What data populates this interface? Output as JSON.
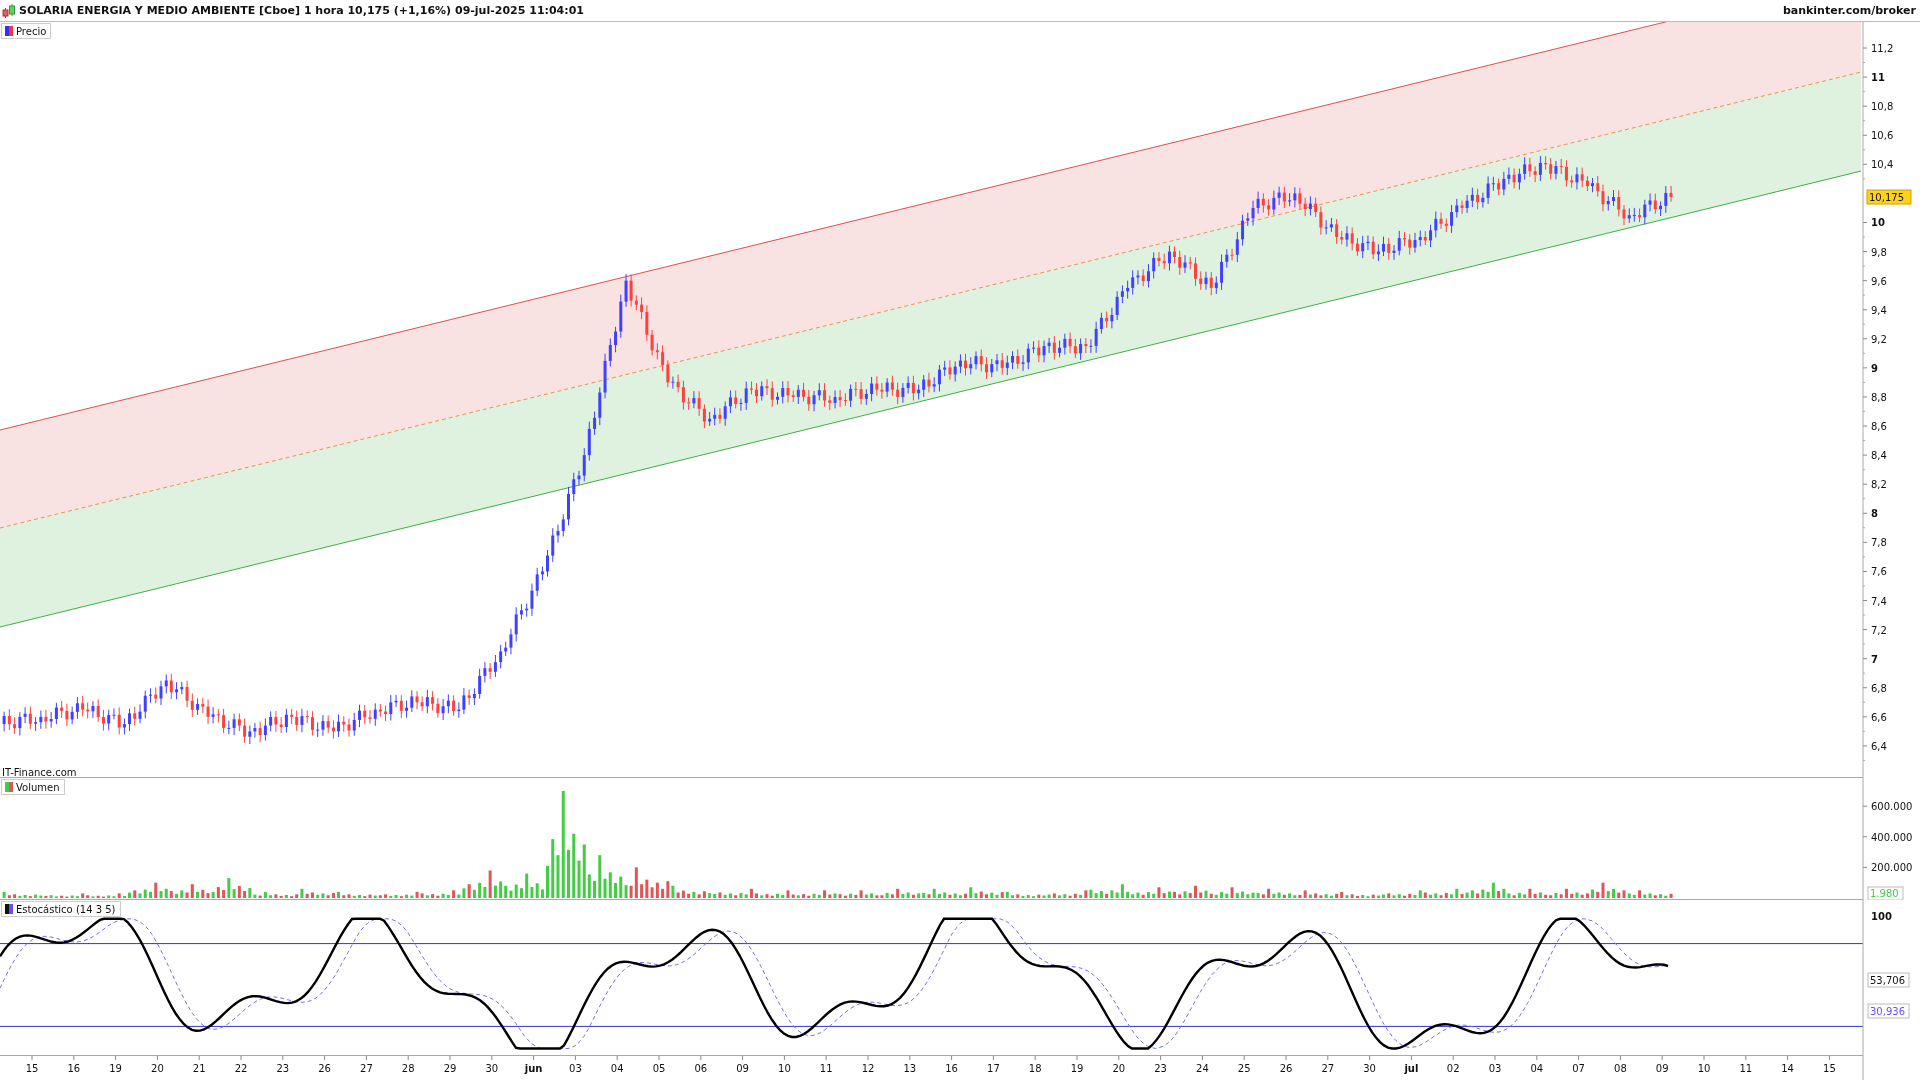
{
  "header": {
    "title": "SOLARIA ENERGIA Y MEDIO AMBIENTE [Cboe] 1 hora 10,175 (+1,16%) 09-jul-2025 11:04:01",
    "site": "bankinter.com/broker"
  },
  "price_pane": {
    "legend": "Precio",
    "credit": "IT-Finance.com",
    "last_price": "10,175",
    "axis_labels": [
      {
        "label": "11,2",
        "major": false
      },
      {
        "label": "11",
        "major": true
      },
      {
        "label": "10,8",
        "major": false
      },
      {
        "label": "10,6",
        "major": false
      },
      {
        "label": "10,4",
        "major": false
      },
      {
        "label": "10",
        "major": true
      },
      {
        "label": "9,8",
        "major": false
      },
      {
        "label": "9,6",
        "major": false
      },
      {
        "label": "9,4",
        "major": false
      },
      {
        "label": "9,2",
        "major": false
      },
      {
        "label": "9",
        "major": true
      },
      {
        "label": "8,8",
        "major": false
      },
      {
        "label": "8,6",
        "major": false
      },
      {
        "label": "8,4",
        "major": false
      },
      {
        "label": "8,2",
        "major": false
      },
      {
        "label": "8",
        "major": true
      },
      {
        "label": "7,8",
        "major": false
      },
      {
        "label": "7,6",
        "major": false
      },
      {
        "label": "7,4",
        "major": false
      },
      {
        "label": "7,2",
        "major": false
      },
      {
        "label": "7",
        "major": true
      },
      {
        "label": "6,8",
        "major": false
      },
      {
        "label": "6,6",
        "major": false
      },
      {
        "label": "6,4",
        "major": false
      }
    ]
  },
  "volume_pane": {
    "legend": "Volumen",
    "last_value": "1.980",
    "axis_labels": [
      "600.000",
      "400.000",
      "200.000"
    ]
  },
  "stoch_pane": {
    "legend": "Estocástico (14 3 5)",
    "top_tick": "100",
    "readings": [
      {
        "kind": "k",
        "value": "53,706"
      },
      {
        "kind": "d",
        "value": "30,936"
      }
    ]
  },
  "x_axis": [
    {
      "label": "15",
      "month": false
    },
    {
      "label": "16",
      "month": false
    },
    {
      "label": "19",
      "month": false
    },
    {
      "label": "20",
      "month": false
    },
    {
      "label": "21",
      "month": false
    },
    {
      "label": "22",
      "month": false
    },
    {
      "label": "23",
      "month": false
    },
    {
      "label": "26",
      "month": false
    },
    {
      "label": "27",
      "month": false
    },
    {
      "label": "28",
      "month": false
    },
    {
      "label": "29",
      "month": false
    },
    {
      "label": "30",
      "month": false
    },
    {
      "label": "jun",
      "month": true
    },
    {
      "label": "03",
      "month": false
    },
    {
      "label": "04",
      "month": false
    },
    {
      "label": "05",
      "month": false
    },
    {
      "label": "06",
      "month": false
    },
    {
      "label": "09",
      "month": false
    },
    {
      "label": "10",
      "month": false
    },
    {
      "label": "11",
      "month": false
    },
    {
      "label": "12",
      "month": false
    },
    {
      "label": "13",
      "month": false
    },
    {
      "label": "16",
      "month": false
    },
    {
      "label": "17",
      "month": false
    },
    {
      "label": "18",
      "month": false
    },
    {
      "label": "19",
      "month": false
    },
    {
      "label": "20",
      "month": false
    },
    {
      "label": "23",
      "month": false
    },
    {
      "label": "24",
      "month": false
    },
    {
      "label": "25",
      "month": false
    },
    {
      "label": "26",
      "month": false
    },
    {
      "label": "27",
      "month": false
    },
    {
      "label": "30",
      "month": false
    },
    {
      "label": "jul",
      "month": true
    },
    {
      "label": "02",
      "month": false
    },
    {
      "label": "03",
      "month": false
    },
    {
      "label": "04",
      "month": false
    },
    {
      "label": "07",
      "month": false
    },
    {
      "label": "08",
      "month": false
    },
    {
      "label": "09",
      "month": false
    },
    {
      "label": "10",
      "month": false
    },
    {
      "label": "11",
      "month": false
    },
    {
      "label": "14",
      "month": false
    },
    {
      "label": "15",
      "month": false
    }
  ]
}
